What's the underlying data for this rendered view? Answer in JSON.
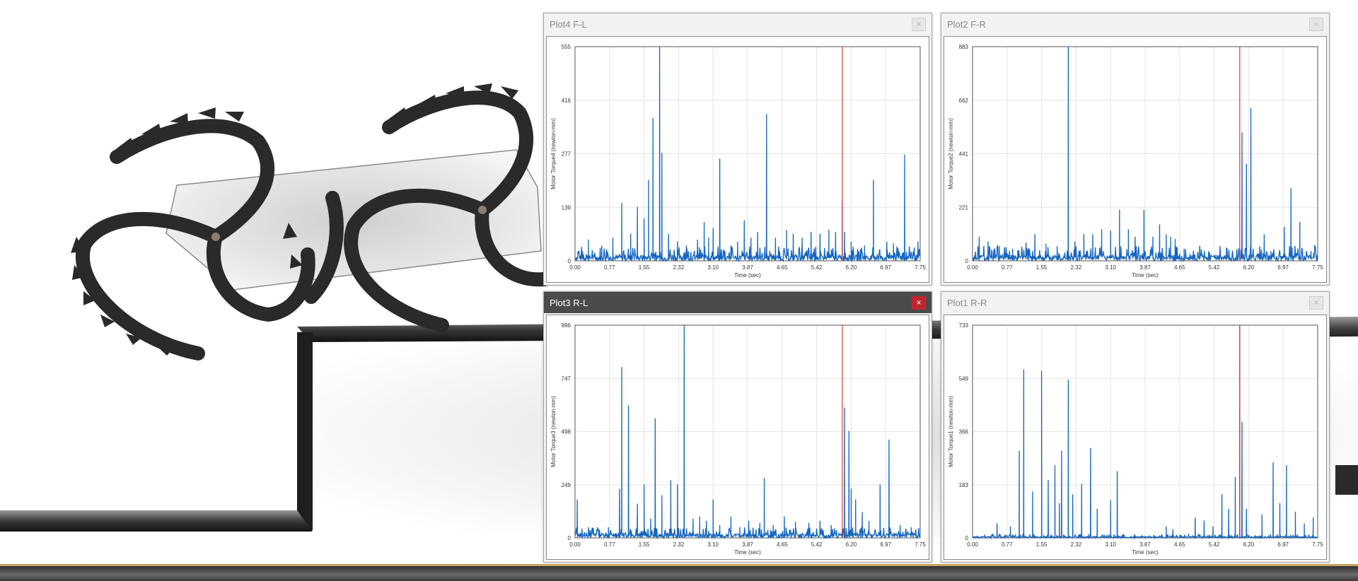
{
  "colors": {
    "series": "#1565c0",
    "cursor": "#e53935",
    "grid": "#e4e4e4",
    "close_active": "#c0262d"
  },
  "icons": {
    "close": "close-icon"
  },
  "windows": [
    {
      "title": "Plot4 F-L",
      "active": false,
      "close_label": "×",
      "chart_data": {
        "type": "line",
        "xlabel": "Time (sec)",
        "ylabel": "Motor Torque4 (newton-mm)",
        "x_ticks": [
          "0.00",
          "0.77",
          "1.55",
          "2.32",
          "3.10",
          "3.87",
          "4.65",
          "5.42",
          "6.20",
          "6.97",
          "7.75"
        ],
        "y_ticks": [
          "0",
          "139",
          "277",
          "416",
          "555"
        ],
        "xlim": [
          0,
          7.75
        ],
        "ylim": [
          0,
          555
        ],
        "cursor_x": 6.0,
        "baseline": 15,
        "spikes": [
          [
            0.3,
            55
          ],
          [
            0.6,
            40
          ],
          [
            0.85,
            60
          ],
          [
            1.05,
            150
          ],
          [
            1.25,
            70
          ],
          [
            1.4,
            140
          ],
          [
            1.55,
            110
          ],
          [
            1.65,
            210
          ],
          [
            1.75,
            370
          ],
          [
            1.9,
            560
          ],
          [
            1.95,
            280
          ],
          [
            2.1,
            70
          ],
          [
            2.3,
            50
          ],
          [
            2.5,
            40
          ],
          [
            2.75,
            55
          ],
          [
            2.9,
            100
          ],
          [
            3.0,
            60
          ],
          [
            3.1,
            85
          ],
          [
            3.25,
            265
          ],
          [
            3.5,
            40
          ],
          [
            3.65,
            50
          ],
          [
            3.8,
            105
          ],
          [
            3.95,
            60
          ],
          [
            4.1,
            75
          ],
          [
            4.3,
            380
          ],
          [
            4.5,
            60
          ],
          [
            4.75,
            80
          ],
          [
            4.9,
            70
          ],
          [
            5.1,
            60
          ],
          [
            5.3,
            75
          ],
          [
            5.5,
            70
          ],
          [
            5.7,
            80
          ],
          [
            5.85,
            75
          ],
          [
            6.0,
            155
          ],
          [
            6.05,
            75
          ],
          [
            6.2,
            50
          ],
          [
            6.5,
            40
          ],
          [
            6.7,
            210
          ],
          [
            7.0,
            50
          ],
          [
            7.15,
            45
          ],
          [
            7.4,
            275
          ],
          [
            7.7,
            50
          ]
        ]
      }
    },
    {
      "title": "Plot2 F-R",
      "active": false,
      "close_label": "×",
      "chart_data": {
        "type": "line",
        "xlabel": "Time (sec)",
        "ylabel": "Motor Torque2 (newton-mm)",
        "x_ticks": [
          "0.00",
          "0.77",
          "1.55",
          "2.32",
          "3.10",
          "3.87",
          "4.65",
          "5.42",
          "6.20",
          "6.97",
          "7.75"
        ],
        "y_ticks": [
          "0",
          "221",
          "441",
          "662",
          "883"
        ],
        "xlim": [
          0,
          7.75
        ],
        "ylim": [
          0,
          883
        ],
        "cursor_x": 6.0,
        "baseline": 25,
        "spikes": [
          [
            0.15,
            100
          ],
          [
            0.35,
            80
          ],
          [
            0.6,
            60
          ],
          [
            0.9,
            50
          ],
          [
            1.2,
            75
          ],
          [
            1.4,
            110
          ],
          [
            1.65,
            70
          ],
          [
            1.9,
            60
          ],
          [
            2.15,
            885
          ],
          [
            2.3,
            80
          ],
          [
            2.5,
            110
          ],
          [
            2.7,
            110
          ],
          [
            2.9,
            130
          ],
          [
            3.1,
            125
          ],
          [
            3.3,
            210
          ],
          [
            3.5,
            130
          ],
          [
            3.65,
            100
          ],
          [
            3.85,
            210
          ],
          [
            4.05,
            100
          ],
          [
            4.2,
            150
          ],
          [
            4.35,
            110
          ],
          [
            4.45,
            100
          ],
          [
            4.55,
            90
          ],
          [
            4.75,
            50
          ],
          [
            5.1,
            60
          ],
          [
            5.3,
            40
          ],
          [
            5.7,
            30
          ],
          [
            6.05,
            530
          ],
          [
            6.15,
            400
          ],
          [
            6.25,
            630
          ],
          [
            6.45,
            60
          ],
          [
            6.55,
            110
          ],
          [
            6.7,
            40
          ],
          [
            7.0,
            140
          ],
          [
            7.15,
            300
          ],
          [
            7.35,
            160
          ],
          [
            7.6,
            40
          ]
        ]
      }
    },
    {
      "title": "Plot3 R-L",
      "active": true,
      "close_label": "×",
      "chart_data": {
        "type": "line",
        "xlabel": "Time (sec)",
        "ylabel": "Motor Torque3 (newton-mm)",
        "x_ticks": [
          "0.00",
          "0.77",
          "1.55",
          "2.32",
          "3.10",
          "3.87",
          "4.65",
          "5.42",
          "6.20",
          "6.97",
          "7.75"
        ],
        "y_ticks": [
          "0",
          "249",
          "498",
          "747",
          "996"
        ],
        "xlim": [
          0,
          7.75
        ],
        "ylim": [
          0,
          996
        ],
        "cursor_x": 6.0,
        "baseline": 20,
        "spikes": [
          [
            0.05,
            180
          ],
          [
            0.3,
            50
          ],
          [
            0.55,
            40
          ],
          [
            0.75,
            50
          ],
          [
            1.0,
            230
          ],
          [
            1.05,
            800
          ],
          [
            1.2,
            620
          ],
          [
            1.4,
            160
          ],
          [
            1.55,
            250
          ],
          [
            1.7,
            90
          ],
          [
            1.8,
            560
          ],
          [
            1.95,
            200
          ],
          [
            2.15,
            270
          ],
          [
            2.3,
            250
          ],
          [
            2.45,
            996
          ],
          [
            2.65,
            90
          ],
          [
            2.8,
            100
          ],
          [
            2.95,
            80
          ],
          [
            3.1,
            180
          ],
          [
            3.25,
            60
          ],
          [
            3.5,
            100
          ],
          [
            3.7,
            50
          ],
          [
            3.9,
            80
          ],
          [
            4.15,
            70
          ],
          [
            4.25,
            280
          ],
          [
            4.45,
            60
          ],
          [
            4.7,
            100
          ],
          [
            4.95,
            75
          ],
          [
            5.25,
            70
          ],
          [
            5.5,
            80
          ],
          [
            5.75,
            60
          ],
          [
            6.05,
            610
          ],
          [
            6.15,
            500
          ],
          [
            6.2,
            230
          ],
          [
            6.3,
            180
          ],
          [
            6.45,
            120
          ],
          [
            6.6,
            80
          ],
          [
            6.85,
            250
          ],
          [
            7.05,
            460
          ],
          [
            7.3,
            60
          ],
          [
            7.55,
            50
          ]
        ]
      }
    },
    {
      "title": "Plot1 R-R",
      "active": false,
      "close_label": "×",
      "chart_data": {
        "type": "line",
        "xlabel": "Time (sec)",
        "ylabel": "Motor Torque1 (newton-mm)",
        "x_ticks": [
          "0.00",
          "0.77",
          "1.55",
          "2.32",
          "3.10",
          "3.87",
          "4.65",
          "5.42",
          "6.20",
          "6.97",
          "7.75"
        ],
        "y_ticks": [
          "0",
          "183",
          "366",
          "549",
          "733"
        ],
        "xlim": [
          0,
          7.75
        ],
        "ylim": [
          0,
          733
        ],
        "cursor_x": 6.0,
        "baseline": 5,
        "spikes": [
          [
            0.55,
            50
          ],
          [
            0.85,
            40
          ],
          [
            1.05,
            300
          ],
          [
            1.15,
            580
          ],
          [
            1.35,
            160
          ],
          [
            1.55,
            575
          ],
          [
            1.7,
            200
          ],
          [
            1.85,
            250
          ],
          [
            1.95,
            120
          ],
          [
            2.0,
            300
          ],
          [
            2.15,
            545
          ],
          [
            2.25,
            150
          ],
          [
            2.45,
            185
          ],
          [
            2.65,
            310
          ],
          [
            2.8,
            100
          ],
          [
            3.1,
            130
          ],
          [
            3.25,
            230
          ],
          [
            4.35,
            40
          ],
          [
            4.5,
            30
          ],
          [
            5.0,
            70
          ],
          [
            5.2,
            60
          ],
          [
            5.4,
            40
          ],
          [
            5.6,
            150
          ],
          [
            5.75,
            100
          ],
          [
            5.9,
            210
          ],
          [
            6.0,
            733
          ],
          [
            6.05,
            400
          ],
          [
            6.15,
            100
          ],
          [
            6.5,
            80
          ],
          [
            6.75,
            260
          ],
          [
            6.9,
            120
          ],
          [
            7.05,
            250
          ],
          [
            7.25,
            90
          ],
          [
            7.45,
            50
          ],
          [
            7.65,
            70
          ]
        ]
      }
    }
  ]
}
